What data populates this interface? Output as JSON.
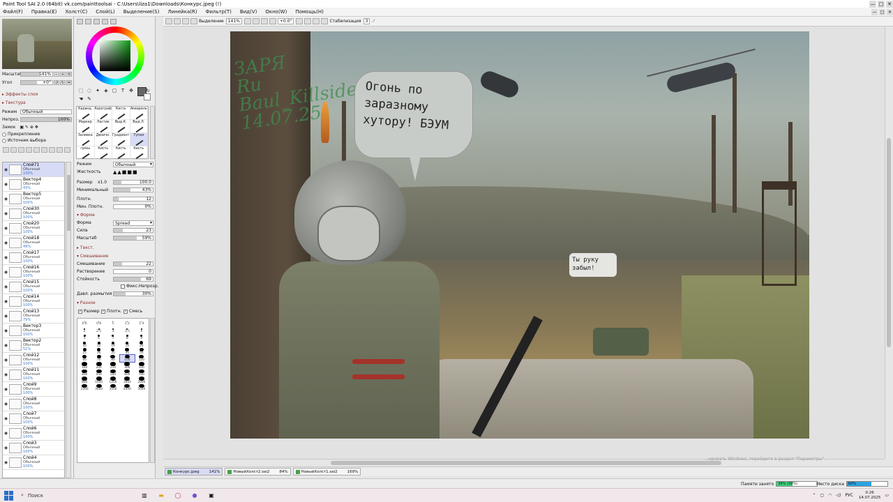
{
  "window": {
    "title": "Paint Tool SAI 2.0 (64bit) vk.com/painttoolsai - C:\\Users\\liza1\\Downloads\\Конкурс.jpeg (!)",
    "controls": [
      "—",
      "□",
      "✕"
    ]
  },
  "menu": [
    "Файл(F)",
    "Правка(E)",
    "Холст(C)",
    "Слой(L)",
    "Выделение(S)",
    "Линейка(R)",
    "Фильтр(T)",
    "Вид(V)",
    "Окно(W)",
    "Помощь(H)"
  ],
  "navigator": {
    "zoom_label": "Масштаб",
    "zoom_value": "141%",
    "angle_label": "Угол",
    "angle_value": "+0°"
  },
  "layer_panel": {
    "effects": "Эффекты слоя",
    "texture": "Текстура",
    "mode_label": "Режим",
    "mode_value": "Обычный",
    "opacity_label": "Непроз.",
    "opacity_value": "100%",
    "lock_label": "Замок",
    "clip_label": "Прикрепление",
    "source_label": "Источник выбора",
    "layers": [
      {
        "name": "Слой71",
        "mode": "Обычный",
        "opacity": "100%",
        "selected": true
      },
      {
        "name": "Вектор4",
        "mode": "Обычный",
        "opacity": "43%"
      },
      {
        "name": "Вектор5",
        "mode": "Обычный",
        "opacity": "100%"
      },
      {
        "name": "Слой30",
        "mode": "Обычный",
        "opacity": "100%"
      },
      {
        "name": "Слой20",
        "mode": "Обычный",
        "opacity": "100%"
      },
      {
        "name": "Слой18",
        "mode": "Обычный",
        "opacity": "49%"
      },
      {
        "name": "Слой17",
        "mode": "Обычный",
        "opacity": "100%"
      },
      {
        "name": "Слой16",
        "mode": "Обычный",
        "opacity": "100%"
      },
      {
        "name": "Слой15",
        "mode": "Обычный",
        "opacity": "100%"
      },
      {
        "name": "Слой14",
        "mode": "Обычный",
        "opacity": "100%"
      },
      {
        "name": "Слой13",
        "mode": "Обычный",
        "opacity": "79%"
      },
      {
        "name": "Вектор3",
        "mode": "Обычный",
        "opacity": "100%"
      },
      {
        "name": "Вектор2",
        "mode": "Обычный",
        "opacity": "51%"
      },
      {
        "name": "Слой12",
        "mode": "Обычный",
        "opacity": "100%"
      },
      {
        "name": "Слой11",
        "mode": "Обычный",
        "opacity": "100%"
      },
      {
        "name": "Слой9",
        "mode": "Обычный",
        "opacity": "100%"
      },
      {
        "name": "Слой8",
        "mode": "Обычный",
        "opacity": "100%"
      },
      {
        "name": "Слой7",
        "mode": "Обычный",
        "opacity": "100%"
      },
      {
        "name": "Слой6",
        "mode": "Обычный",
        "opacity": "100%"
      },
      {
        "name": "Слой3",
        "mode": "Обычный",
        "opacity": "100%"
      },
      {
        "name": "Слой4",
        "mode": "Обычный",
        "opacity": "100%"
      }
    ]
  },
  "tool_panel": {
    "brushes": [
      {
        "name": "Каранд."
      },
      {
        "name": "Аэрограф"
      },
      {
        "name": "Кисть"
      },
      {
        "name": "Акварель"
      },
      {
        "name": "Маркер"
      },
      {
        "name": "Ластик"
      },
      {
        "name": "Выд.К."
      },
      {
        "name": "Выд.Л."
      },
      {
        "name": "Заливка"
      },
      {
        "name": "Двоичн."
      },
      {
        "name": "Градиент"
      },
      {
        "name": "Тупая",
        "selected": true
      },
      {
        "name": "грязь"
      },
      {
        "name": "Кисть"
      },
      {
        "name": "Кисть"
      },
      {
        "name": "Кисть"
      }
    ],
    "mode_label": "Режим",
    "mode_value": "Обычный",
    "hardness_label": "Жесткость",
    "size_label": "Размер",
    "size_mult": "x1.0",
    "size_value": "100.0",
    "min_label": "Минимальный",
    "min_value": "43%",
    "density_label": "Плотн.",
    "density_value": "12",
    "min_density_label": "Мин. Плотн.",
    "min_density_value": "0%",
    "shape_section": "Форма",
    "shape_label": "Форма",
    "shape_value": "Spread",
    "force_label": "Сила",
    "force_value": "23",
    "scale_label": "Масштаб",
    "scale_value": "59%",
    "texture_section": "Текст.",
    "mixing_section": "Смешивание",
    "mix_label": "Смешивание",
    "mix_value": "22",
    "dilute_label": "Растворение",
    "dilute_value": "0",
    "persist_label": "Стойкость",
    "persist_value": "69",
    "fix_opacity": "Фикс.Непрозр.",
    "blur_label": "Давл. размытия",
    "blur_value": "30%",
    "misc_section": "Разное",
    "chk_size": "Размер",
    "chk_density": "Плотн.",
    "chk_blend": "Смесь",
    "sizes": [
      "0.6",
      "0.8",
      "1",
      "1.2",
      "1.4",
      "2",
      "2.5",
      "3",
      "3.5",
      "4",
      "5",
      "6",
      "7",
      "8",
      "9",
      "10",
      "12",
      "14",
      "16",
      "20",
      "25",
      "30",
      "35",
      "40",
      "50",
      "60",
      "70",
      "80",
      "100",
      "120",
      "160",
      "200",
      "250",
      "300",
      "350",
      "400",
      "450",
      "500",
      "600",
      "700",
      "800",
      "1000",
      "1200",
      "1600",
      "2000",
      "2500",
      "3000",
      "3500",
      "4000",
      "5000"
    ],
    "selected_size": "100"
  },
  "canvas_toolbar": {
    "selection_label": "Выделение",
    "zoom": "141%",
    "angle": "+0.0°",
    "stabilizer_label": "Стабилизация",
    "stabilizer_value": "3"
  },
  "artwork": {
    "bubble_text": "Огонь по заразному хутору! БЭУМ",
    "bubble2_text": "Ты руку забыл!",
    "wall_text": "ЗАРЯ\nRu\nBaul_Killside\n14.07.25"
  },
  "doc_tabs": [
    {
      "name": "Конкурс.jpeg",
      "zoom": "141%",
      "active": true
    },
    {
      "name": "НовыйХолст2.sai2",
      "zoom": "84%"
    },
    {
      "name": "НовыйХолст1.sai2",
      "zoom": "169%"
    }
  ],
  "status": {
    "memory_label": "Памяти занято",
    "memory_value": "39% (39%)",
    "memory_fraction": 0.39,
    "disk_label": "Место диска",
    "disk_value": "60%",
    "disk_fraction": 0.6,
    "watermark": "...ировать Windows, перейдите в раздел \"Параметры\"."
  },
  "taskbar": {
    "search": "Поиск",
    "lang": "РУС",
    "time": "0:26",
    "date": "14.07.2025"
  },
  "colors": {
    "accent_selected": "#d7dbf5",
    "section_red": "#8b2d2d",
    "memory_fill": "#3fd07a",
    "disk_fill": "#2aa3e0"
  }
}
